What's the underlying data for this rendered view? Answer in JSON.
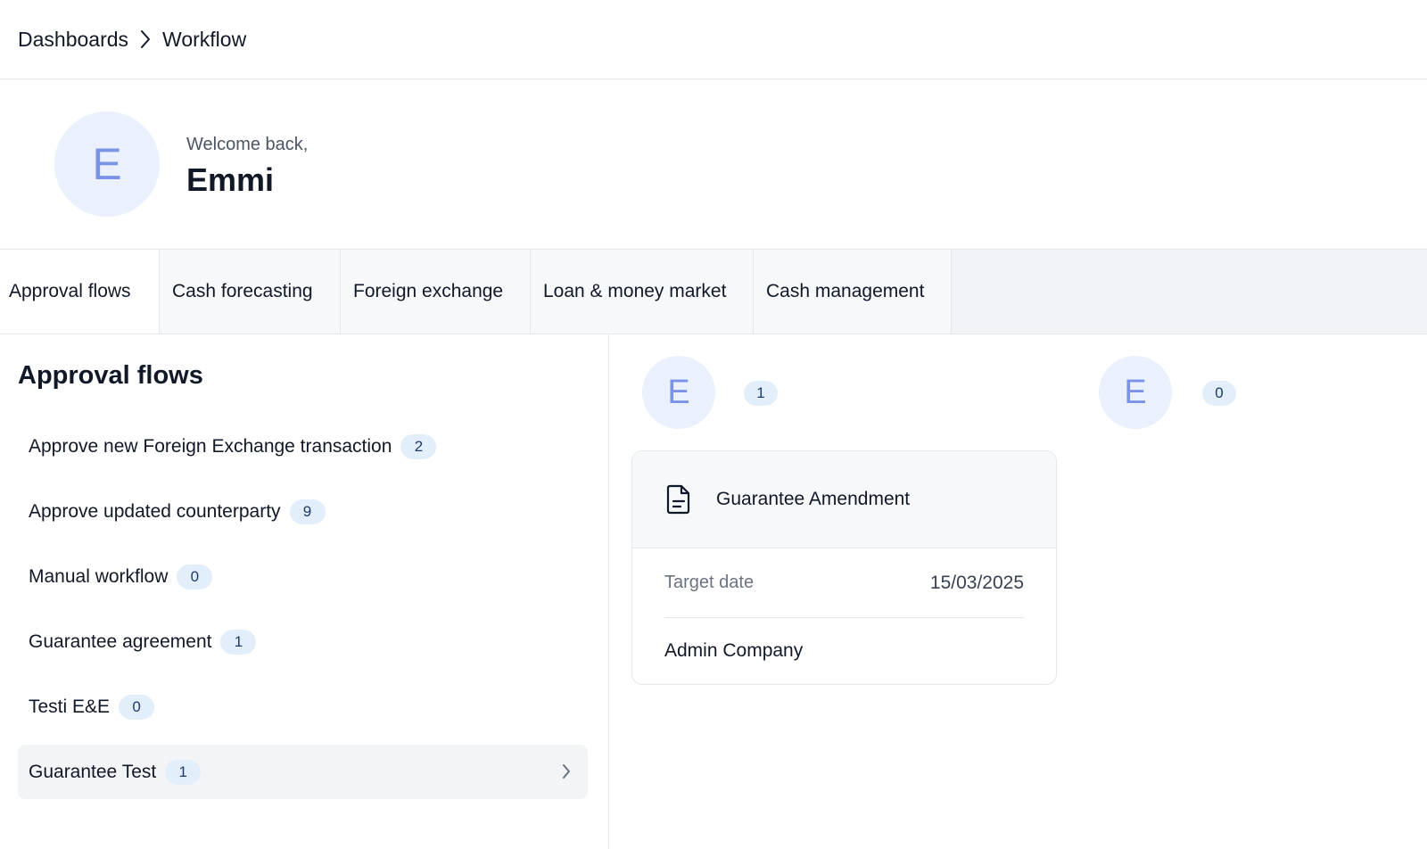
{
  "breadcrumb": {
    "items": [
      "Dashboards",
      "Workflow"
    ]
  },
  "welcome": {
    "avatar_initial": "E",
    "greeting": "Welcome back,",
    "name": "Emmi"
  },
  "tabs": [
    {
      "label": "Approval flows",
      "active": true
    },
    {
      "label": "Cash forecasting",
      "active": false
    },
    {
      "label": "Foreign exchange",
      "active": false
    },
    {
      "label": "Loan & money market",
      "active": false
    },
    {
      "label": "Cash management",
      "active": false
    }
  ],
  "approval_flows": {
    "title": "Approval flows",
    "items": [
      {
        "label": "Approve new Foreign Exchange transaction",
        "count": "2"
      },
      {
        "label": "Approve updated counterparty",
        "count": "9"
      },
      {
        "label": "Manual workflow",
        "count": "0"
      },
      {
        "label": "Guarantee agreement",
        "count": "1"
      },
      {
        "label": "Testi E&E",
        "count": "0"
      },
      {
        "label": "Guarantee Test",
        "count": "1",
        "selected": true
      }
    ]
  },
  "columns": [
    {
      "avatar_initial": "E",
      "count": "1"
    },
    {
      "avatar_initial": "E",
      "count": "0"
    }
  ],
  "card": {
    "icon": "document-icon",
    "title": "Guarantee Amendment",
    "target_date_label": "Target date",
    "target_date": "15/03/2025",
    "company": "Admin Company"
  },
  "colors": {
    "avatar_bg": "#eaf0fc",
    "avatar_text": "#7b93e6",
    "badge_bg": "#e3eefb",
    "badge_text": "#1e3a6a",
    "selected_bg": "#f3f4f6"
  }
}
